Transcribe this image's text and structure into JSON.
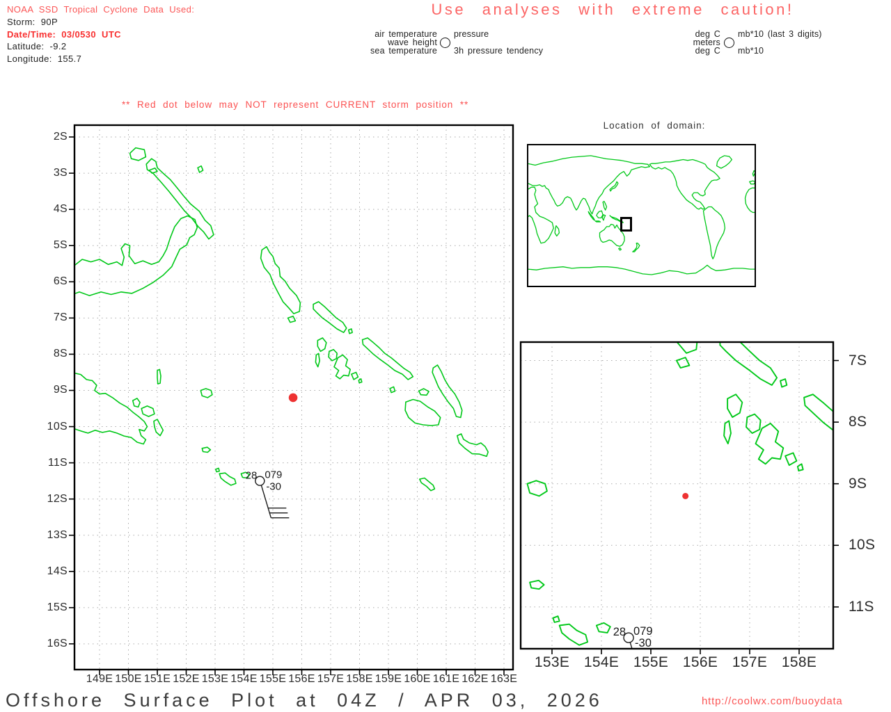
{
  "header": {
    "source_line": "NOAA SSD Tropical Cyclone Data Used:",
    "storm": "Storm: 90P",
    "datetime": "Date/Time: 03/0530 UTC",
    "latitude": "Latitude: -9.2",
    "longitude": "Longitude: 155.7"
  },
  "caution_title": "Use analyses with extreme caution!",
  "legend": {
    "air_temperature": "air temperature",
    "wave_height": "wave height",
    "sea_temperature": "sea temperature",
    "pressure": "pressure",
    "pressure_tendency": "3h pressure tendency",
    "deg_c_air": "deg C",
    "meters": "meters",
    "deg_c_sea": "deg C",
    "mb10_pressure": "mb*10 (last 3 digits)",
    "mb10_tendency": "mb*10"
  },
  "warning": "** Red dot below may NOT represent CURRENT storm position **",
  "inset": {
    "title": "Location of domain:"
  },
  "main_map": {
    "lon_labels": [
      "149E",
      "150E",
      "151E",
      "152E",
      "153E",
      "154E",
      "155E",
      "156E",
      "157E",
      "158E",
      "159E",
      "160E",
      "161E",
      "162E",
      "163E"
    ],
    "lat_labels": [
      "2S",
      "3S",
      "4S",
      "5S",
      "6S",
      "7S",
      "8S",
      "9S",
      "10S",
      "11S",
      "12S",
      "13S",
      "14S",
      "15S",
      "16S"
    ]
  },
  "zoom_map": {
    "lon_labels": [
      "153E",
      "154E",
      "155E",
      "156E",
      "157E",
      "158E"
    ],
    "lat_labels": [
      "7S",
      "8S",
      "9S",
      "10S",
      "11S"
    ]
  },
  "storm_position": {
    "lat": -9.2,
    "lon": 155.7
  },
  "observation": {
    "lon": 154.55,
    "lat": -11.5,
    "air_temp": "28",
    "pressure": "079",
    "tendency": "-30"
  },
  "footer": {
    "title": "Offshore Surface Plot at 04Z / APR 03, 2026",
    "url": "http://coolwx.com/buoydata"
  },
  "colors": {
    "coastline_green": "#00c818",
    "salmon_red": "#fb5555",
    "alert_red": "#f82f2f",
    "storm_dot_red": "#ee3232",
    "grid_gray": "#aaaaaa"
  }
}
